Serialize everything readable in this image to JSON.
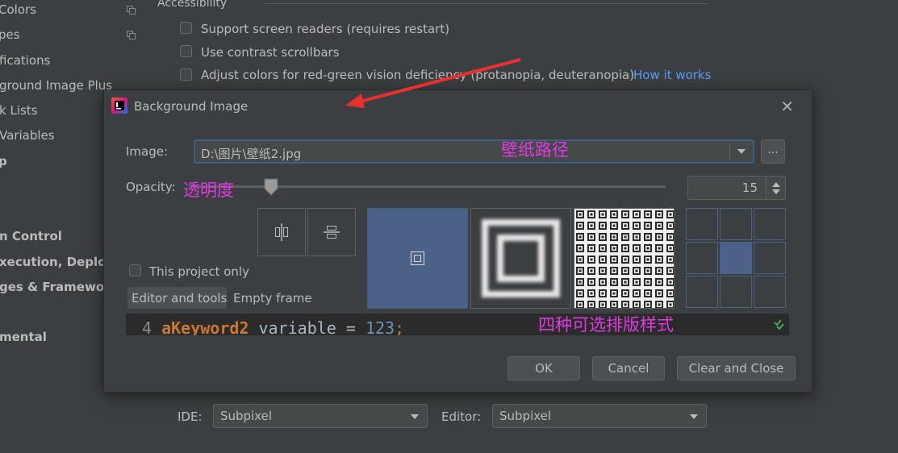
{
  "sidebar": {
    "items": [
      {
        "label": "Colors",
        "copy": true
      },
      {
        "label": "pes",
        "copy": true
      },
      {
        "label": "fications"
      },
      {
        "label": "ground Image Plus"
      },
      {
        "label": "k Lists"
      },
      {
        "label": "Variables"
      },
      {
        "label": "p",
        "bold": true
      },
      {
        "label": "n Control",
        "bold": true
      },
      {
        "label": "xecution, Deploy",
        "bold": true
      },
      {
        "label": "ges & Framewor",
        "bold": true
      },
      {
        "label": "mental",
        "bold": true
      }
    ]
  },
  "accessibility": {
    "title": "Accessibility",
    "options": [
      "Support screen readers (requires restart)",
      "Use contrast scrollbars",
      "Adjust colors for red-green vision deficiency (protanopia, deuteranopia)"
    ],
    "link": "How it works"
  },
  "dialog": {
    "title": "Background Image",
    "image_label": "Image:",
    "image_path": "D:\\图片\\壁纸2.jpg",
    "browse_label": "...",
    "opacity_label": "Opacity:",
    "opacity_value": "15",
    "opacity_fraction": 0.15,
    "this_project_only": "This project only",
    "tabs": [
      "Editor and tools",
      "Empty frame"
    ],
    "selected_tab": 0,
    "code": {
      "line": "4",
      "keyword": "aKeyword2",
      "text": " variable = ",
      "number": "123",
      "end": ";"
    },
    "buttons": {
      "ok": "OK",
      "cancel": "Cancel",
      "clear": "Clear and Close"
    }
  },
  "annotations": {
    "path_note": "壁纸路径",
    "opacity_note": "透明度",
    "layout_note": "四种可选排版样式"
  },
  "antialias": {
    "ide_label": "IDE:",
    "ide_value": "Subpixel",
    "editor_label": "Editor:",
    "editor_value": "Subpixel"
  },
  "colors": {
    "background": "#3c3f41",
    "accent": "#4b6188",
    "link": "#589df6",
    "annotation": "#e03ae0",
    "arrow": "#e8312f"
  }
}
